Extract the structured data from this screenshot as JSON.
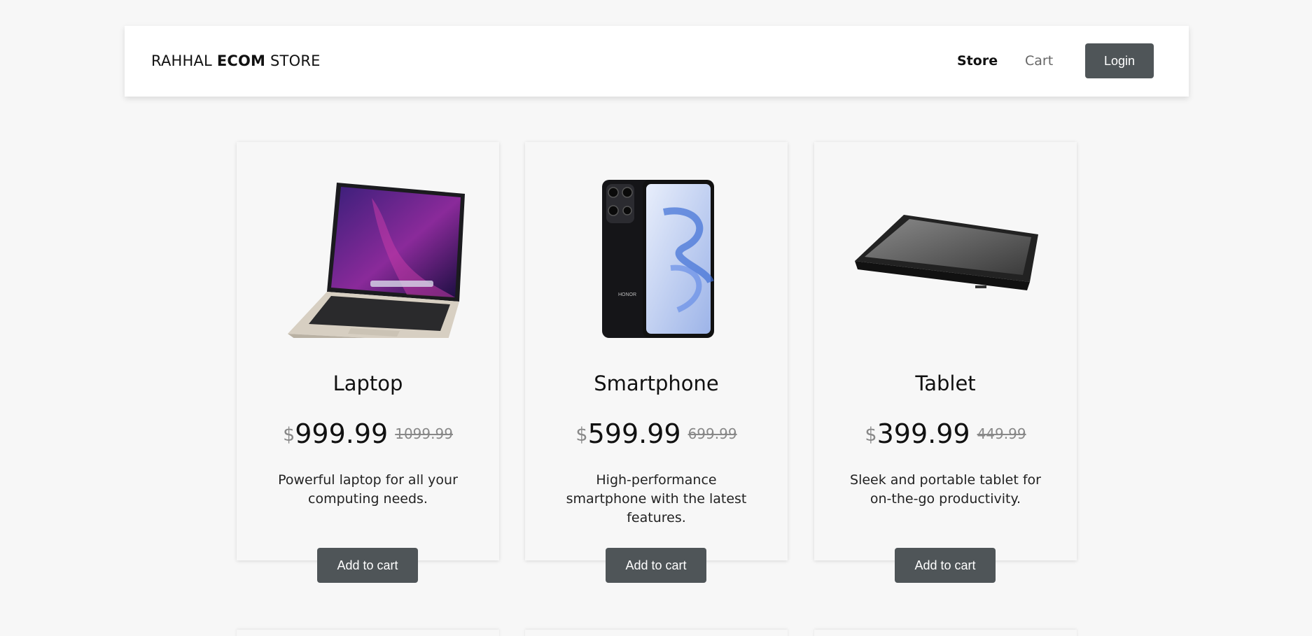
{
  "header": {
    "brand_prefix": "RAHHAL ",
    "brand_bold": "ECOM",
    "brand_suffix": " STORE",
    "nav": {
      "store": "Store",
      "cart": "Cart"
    },
    "login_label": "Login"
  },
  "products": [
    {
      "name": "Laptop",
      "currency": "$",
      "price": "999.99",
      "old_price": "1099.99",
      "description": "Powerful laptop for all your computing needs.",
      "button": "Add to cart",
      "image": "laptop-image"
    },
    {
      "name": "Smartphone",
      "currency": "$",
      "price": "599.99",
      "old_price": "699.99",
      "description": "High-performance smartphone with the latest features.",
      "button": "Add to cart",
      "image": "smartphone-image",
      "image_text": "HONOR"
    },
    {
      "name": "Tablet",
      "currency": "$",
      "price": "399.99",
      "old_price": "449.99",
      "description": "Sleek and portable tablet for on-the-go productivity.",
      "button": "Add to cart",
      "image": "tablet-image"
    }
  ],
  "colors": {
    "background": "#f7f7f7",
    "button": "#4f5558",
    "muted_text": "#888888"
  }
}
